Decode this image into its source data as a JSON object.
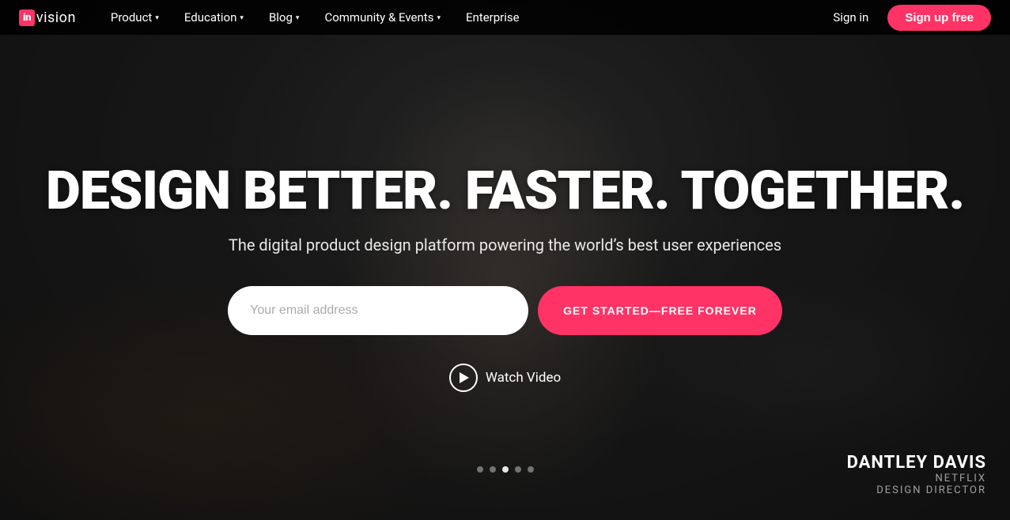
{
  "nav": {
    "logo_in": "in",
    "logo_vision": "vision",
    "items": [
      {
        "label": "Product",
        "has_dropdown": true
      },
      {
        "label": "Education",
        "has_dropdown": true
      },
      {
        "label": "Blog",
        "has_dropdown": true
      },
      {
        "label": "Community & Events",
        "has_dropdown": true
      },
      {
        "label": "Enterprise",
        "has_dropdown": false
      }
    ],
    "sign_in": "Sign in",
    "sign_up": "Sign up free"
  },
  "hero": {
    "title": "DESIGN BETTER. FASTER. TOGETHER.",
    "subtitle": "The digital product design platform powering the world’s best user experiences",
    "email_placeholder": "Your email address",
    "cta_button": "GET STARTED—FREE FOREVER",
    "watch_video": "Watch Video"
  },
  "attribution": {
    "name": "DANTLEY DAVIS",
    "company": "NETFLIX",
    "role": "DESIGN DIRECTOR"
  },
  "carousel": {
    "dots": [
      false,
      false,
      true,
      false,
      false
    ]
  }
}
